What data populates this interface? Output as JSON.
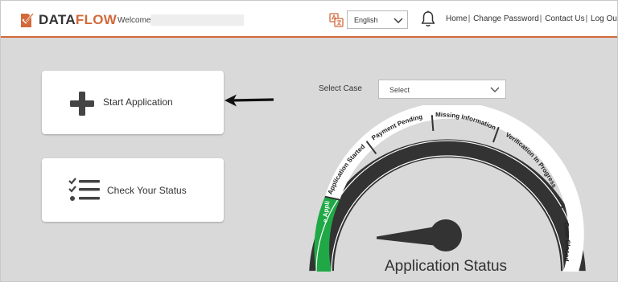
{
  "header": {
    "brand_part1": "DATA",
    "brand_part2": "FLOW",
    "welcome_label": "Welcome",
    "language": "English",
    "nav": [
      "Home",
      "Change Password",
      "Contact Us",
      "Log Out"
    ],
    "nav_separator": "|"
  },
  "main": {
    "start_application_label": "Start Application",
    "check_status_label": "Check Your Status",
    "select_case_label": "Select Case",
    "select_case_value": "Select"
  },
  "gauge": {
    "title": "Application Status",
    "stages": [
      "Create Application",
      "Application Started",
      "Payment Pending",
      "Missing Information",
      "Verification In Progress",
      "Case Closed"
    ],
    "active_stage": "Create Application"
  },
  "colors": {
    "brand": "#d2693a",
    "gauge_dark": "#3a3a3a",
    "active_stage": "#1fa845"
  }
}
